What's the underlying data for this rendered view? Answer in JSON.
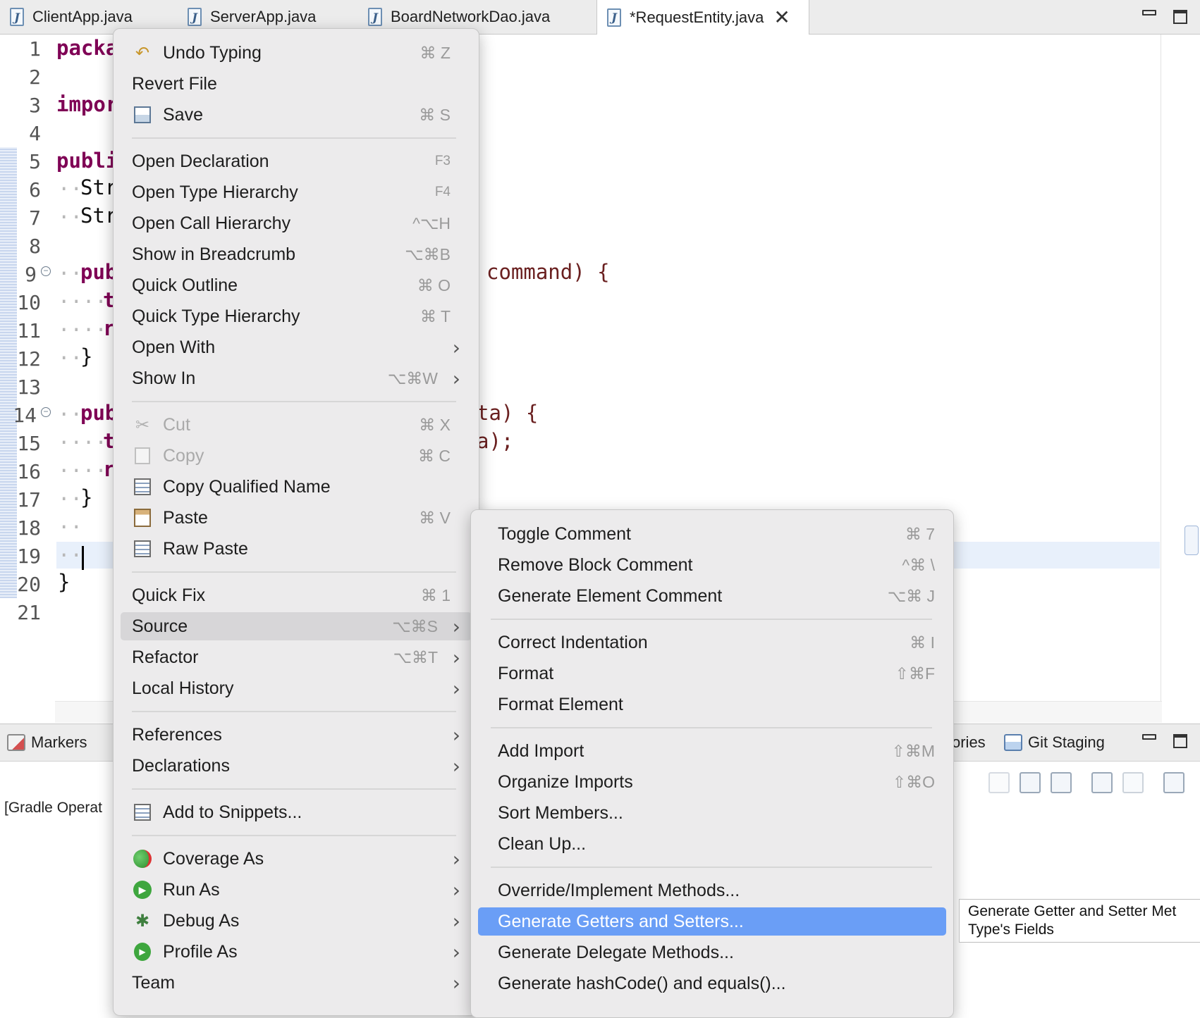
{
  "tabs": [
    {
      "label": "ClientApp.java"
    },
    {
      "label": "ServerApp.java"
    },
    {
      "label": "BoardNetworkDao.java"
    },
    {
      "label": "*RequestEntity.java"
    }
  ],
  "editor": {
    "line_numbers": [
      "1",
      "2",
      "3",
      "4",
      "5",
      "6",
      "7",
      "8",
      "9",
      "10",
      "11",
      "12",
      "13",
      "14",
      "15",
      "16",
      "17",
      "18",
      "19",
      "20",
      "21"
    ],
    "visible_code": {
      "l1": "packa",
      "l3": "impor",
      "l5": "publi",
      "l6": "Str",
      "l7": "Str",
      "l9": "pub",
      "l9_tail": "command) {",
      "l10": "t",
      "l11": "r",
      "l12": "}",
      "l14": "pub",
      "l14_tail": "ta) {",
      "l15": "t",
      "l15_tail": "a);",
      "l16": "r",
      "l17": "}",
      "l20": "}"
    }
  },
  "bottom_panel": {
    "tabs": [
      {
        "label": "Markers"
      },
      {
        "label": "ories"
      },
      {
        "label": "Git Staging"
      }
    ],
    "console_text": "[Gradle Operat"
  },
  "context_menu": {
    "items": [
      {
        "label": "Undo Typing",
        "shortcut": "⌘ Z",
        "icon": "undo-icon"
      },
      {
        "label": "Revert File"
      },
      {
        "label": "Save",
        "shortcut": "⌘ S",
        "icon": "save-icon"
      },
      {
        "label": "Open Declaration",
        "shortcut": "F3"
      },
      {
        "label": "Open Type Hierarchy",
        "shortcut": "F4"
      },
      {
        "label": "Open Call Hierarchy",
        "shortcut": "^⌥H"
      },
      {
        "label": "Show in Breadcrumb",
        "shortcut": "⌥⌘B"
      },
      {
        "label": "Quick Outline",
        "shortcut": "⌘ O"
      },
      {
        "label": "Quick Type Hierarchy",
        "shortcut": "⌘ T"
      },
      {
        "label": "Open With",
        "submenu": true
      },
      {
        "label": "Show In",
        "shortcut": "⌥⌘W",
        "submenu": true
      },
      {
        "label": "Cut",
        "shortcut": "⌘ X",
        "disabled": true,
        "icon": "scissors-icon"
      },
      {
        "label": "Copy",
        "shortcut": "⌘ C",
        "disabled": true,
        "icon": "copy-icon"
      },
      {
        "label": "Copy Qualified Name",
        "icon": "copy-qualified-icon"
      },
      {
        "label": "Paste",
        "shortcut": "⌘ V",
        "icon": "paste-icon"
      },
      {
        "label": "Raw Paste",
        "icon": "raw-paste-icon"
      },
      {
        "label": "Quick Fix",
        "shortcut": "⌘ 1"
      },
      {
        "label": "Source",
        "shortcut": "⌥⌘S",
        "submenu": true,
        "hover": true
      },
      {
        "label": "Refactor",
        "shortcut": "⌥⌘T",
        "submenu": true
      },
      {
        "label": "Local History",
        "submenu": true
      },
      {
        "label": "References",
        "submenu": true
      },
      {
        "label": "Declarations",
        "submenu": true
      },
      {
        "label": "Add to Snippets...",
        "icon": "snippet-icon"
      },
      {
        "label": "Coverage As",
        "submenu": true,
        "icon": "coverage-icon"
      },
      {
        "label": "Run As",
        "submenu": true,
        "icon": "run-icon"
      },
      {
        "label": "Debug As",
        "submenu": true,
        "icon": "bug-icon"
      },
      {
        "label": "Profile As",
        "submenu": true,
        "icon": "profile-icon"
      },
      {
        "label": "Team",
        "submenu": true
      }
    ]
  },
  "source_submenu": {
    "items": [
      {
        "label": "Toggle Comment",
        "shortcut": "⌘ 7"
      },
      {
        "label": "Remove Block Comment",
        "shortcut": "^⌘ \\"
      },
      {
        "label": "Generate Element Comment",
        "shortcut": "⌥⌘ J"
      },
      {
        "label": "Correct Indentation",
        "shortcut": "⌘ I"
      },
      {
        "label": "Format",
        "shortcut": "⇧⌘F"
      },
      {
        "label": "Format Element"
      },
      {
        "label": "Add Import",
        "shortcut": "⇧⌘M"
      },
      {
        "label": "Organize Imports",
        "shortcut": "⇧⌘O"
      },
      {
        "label": "Sort Members..."
      },
      {
        "label": "Clean Up..."
      },
      {
        "label": "Override/Implement Methods..."
      },
      {
        "label": "Generate Getters and Setters...",
        "selected": true
      },
      {
        "label": "Generate Delegate Methods..."
      },
      {
        "label": "Generate hashCode() and equals()..."
      }
    ]
  },
  "tooltip": {
    "line1": "Generate Getter and Setter Met",
    "line2": "Type's Fields"
  },
  "colors": {
    "selection": "#6a9ef6",
    "keyword": "#7f0055",
    "menu_bg": "#ecebec"
  }
}
